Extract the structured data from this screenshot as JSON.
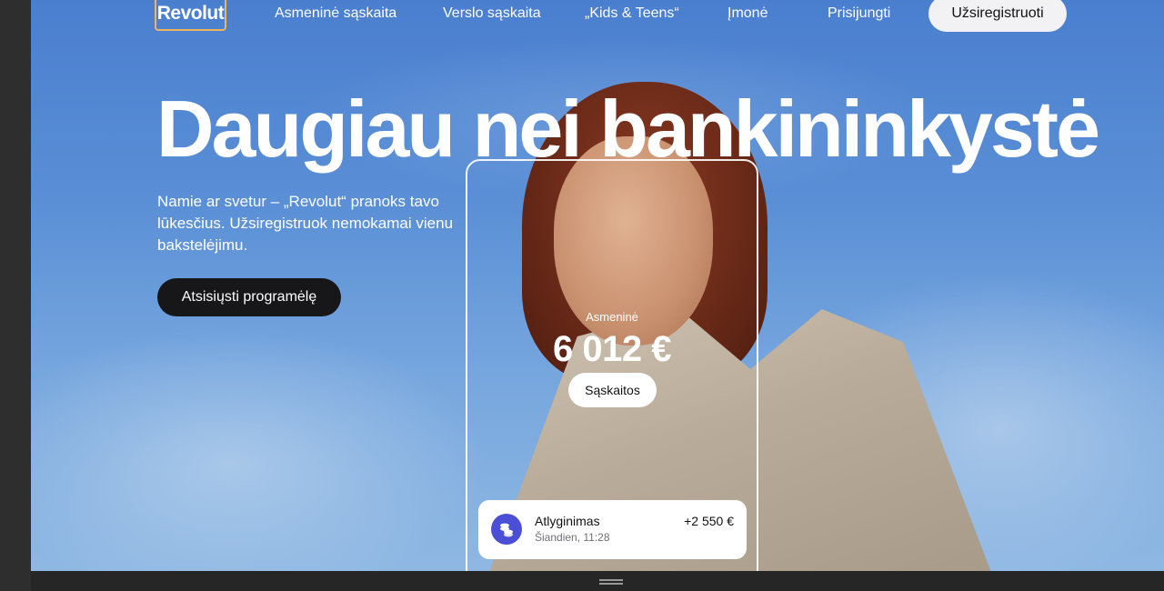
{
  "nav": {
    "logo": "Revolut",
    "links": [
      "Asmeninė sąskaita",
      "Verslo sąskaita",
      "„Kids & Teens“",
      "Įmonė",
      "Prisijungti"
    ],
    "signup_label": "Užsiregistruoti"
  },
  "hero": {
    "headline": "Daugiau nei bankininkystė",
    "subtext": "Namie ar svetur – „Revolut“ pranoks tavo lūkesčius. Užsiregistruok nemokamai vienu bakstelėjimu.",
    "download_label": "Atsisiųsti programėlę"
  },
  "phone": {
    "account_label": "Asmeninė",
    "balance": "6 012 €",
    "accounts_button": "Sąskaitos",
    "transaction": {
      "title": "Atlyginimas",
      "time": "Šiandien, 11:28",
      "amount": "+2 550 €",
      "icon": "coins-icon"
    }
  },
  "colors": {
    "sky": "#5a8fd6",
    "logo_border": "#f0b45a",
    "dark_button": "#17171a",
    "tx_icon_bg": "#4b4fd6"
  }
}
